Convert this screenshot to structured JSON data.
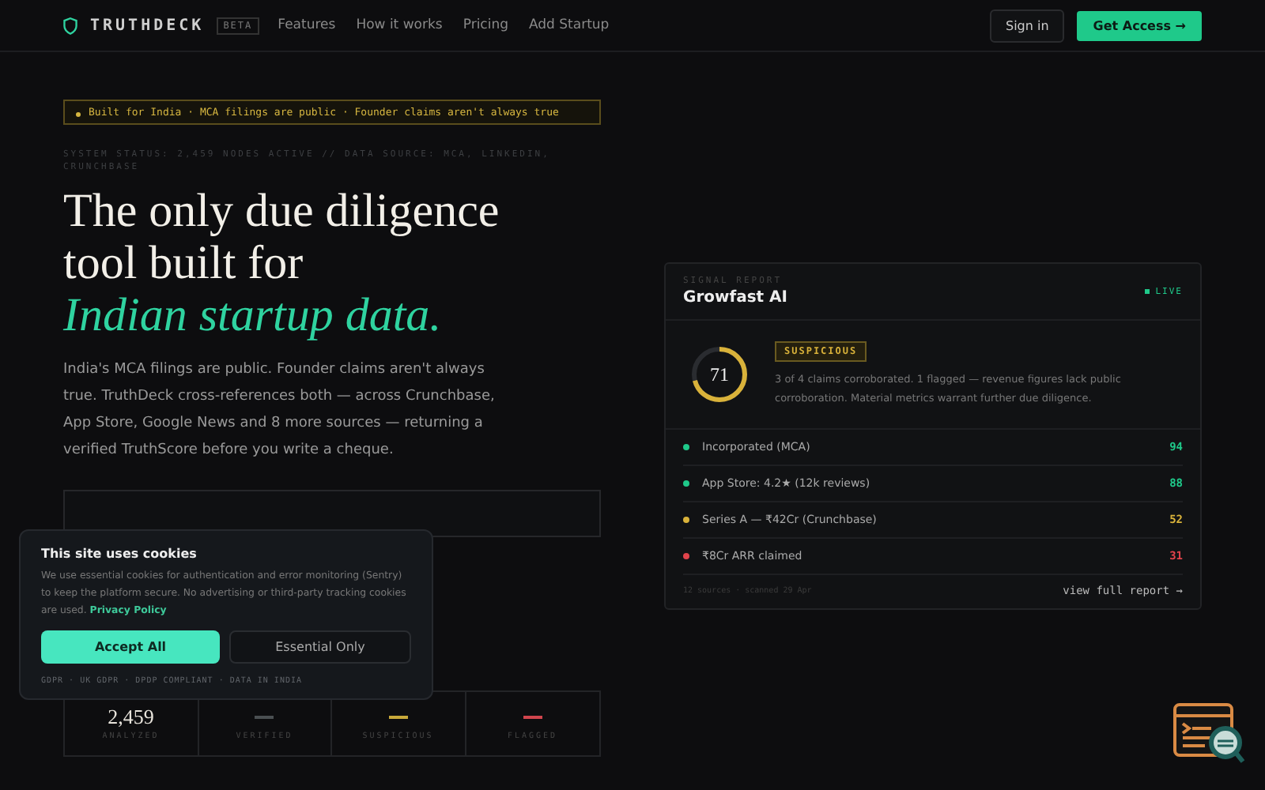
{
  "nav": {
    "brand": "TRUTHDECK",
    "badge": "BETA",
    "links": [
      "Features",
      "How it works",
      "Pricing",
      "Add Startup"
    ],
    "sign_in": "Sign in",
    "cta": "Get Access →"
  },
  "hero": {
    "notice": "Built for India · MCA filings are public · Founder claims aren't always true",
    "status": "SYSTEM STATUS: 2,459 NODES ACTIVE // DATA SOURCE: MCA, LINKEDIN, CRUNCHBASE",
    "headline_lines": [
      "The only due diligence",
      "tool built for"
    ],
    "headline_accent": "Indian startup data.",
    "body": "India's MCA filings are public. Founder claims aren't always true. TruthDeck cross-references both — across Crunchbase, App Store, Google News and 8 more sources — returning a verified TruthScore before you write a cheque."
  },
  "stats": [
    {
      "value": "2,459",
      "label": "ANALYZED",
      "color": "#e8e4dc"
    },
    {
      "label": "VERIFIED",
      "color": "#4a4f52"
    },
    {
      "label": "SUSPICIOUS",
      "color": "#c9a93a"
    },
    {
      "label": "FLAGGED",
      "color": "#d0454d"
    }
  ],
  "report": {
    "eyebrow": "SIGNAL REPORT",
    "title": "Growfast AI",
    "live": "LIVE",
    "score": "71",
    "level": 0.71,
    "verdict": "SUSPICIOUS",
    "summary": "3 of 4 claims corroborated. 1 flagged — revenue figures lack public corroboration. Material metrics warrant further due diligence.",
    "signals": [
      {
        "label": "Incorporated (MCA)",
        "score": "94",
        "color": "#1fc98a"
      },
      {
        "label": "App Store: 4.2★ (12k reviews)",
        "score": "88",
        "color": "#1fc98a"
      },
      {
        "label": "Series A — ₹42Cr (Crunchbase)",
        "score": "52",
        "color": "#d9b23a"
      },
      {
        "label": "₹8Cr ARR claimed",
        "score": "31",
        "color": "#e0434b"
      }
    ],
    "footer": "12 sources · scanned 29 Apr",
    "link": "view full report →"
  },
  "cookies": {
    "title": "This site uses cookies",
    "body": "We use essential cookies for authentication and error monitoring (Sentry) to keep the platform secure. No advertising or third-party tracking cookies are used.",
    "link": "Privacy Policy",
    "accept": "Accept All",
    "essential": "Essential Only",
    "note": "GDPR · UK GDPR · DPDP COMPLIANT · DATA IN INDIA"
  }
}
